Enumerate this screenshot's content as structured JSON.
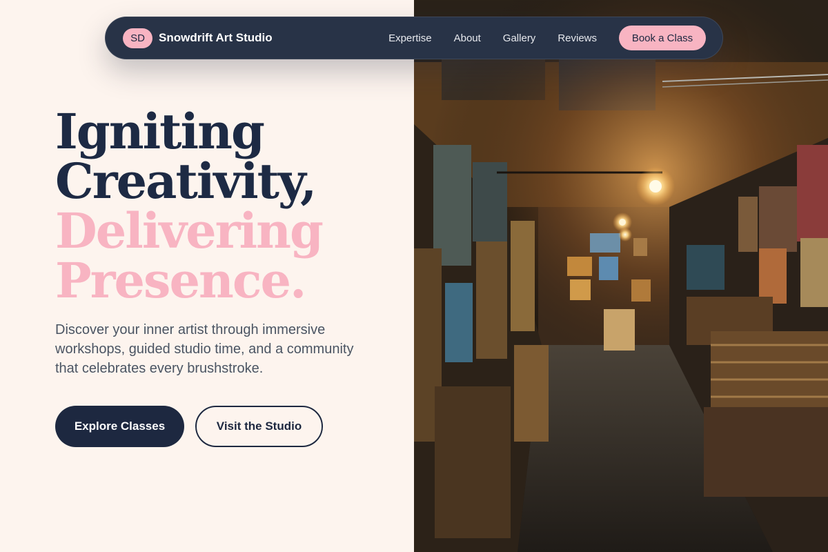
{
  "brand": {
    "badge": "SD",
    "name": "Snowdrift Art Studio"
  },
  "nav": {
    "links": [
      "Expertise",
      "About",
      "Gallery",
      "Reviews"
    ],
    "cta": "Book a Class"
  },
  "hero": {
    "title_lines": [
      "Igniting",
      "Creativity,",
      "Delivering",
      "Presence."
    ],
    "subtitle": "Discover your inner artist through immersive workshops, guided studio time, and a community that celebrates every brushstroke.",
    "primary_button": "Explore Classes",
    "secondary_button": "Visit the Studio"
  },
  "colors": {
    "background": "#fdf4ee",
    "navy": "#1d2840",
    "accent_pink": "#f8b4c2"
  }
}
